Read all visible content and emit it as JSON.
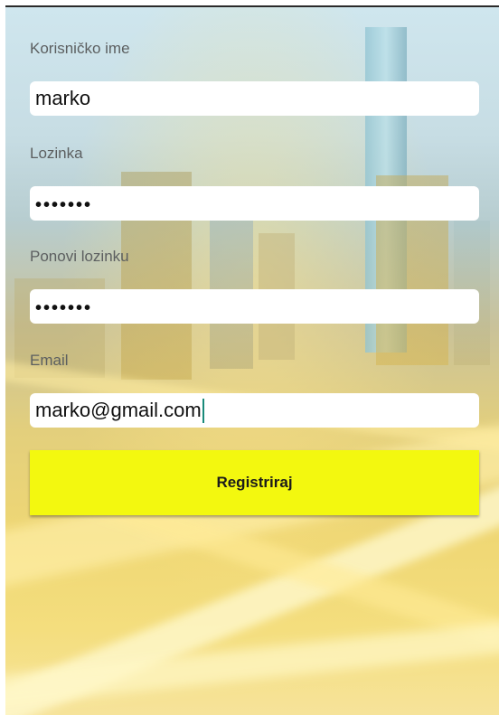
{
  "form": {
    "username_label": "Korisničko ime",
    "username_value": "marko",
    "password_label": "Lozinka",
    "password_value": "•••••••",
    "repeat_label": "Ponovi lozinku",
    "repeat_value": "•••••••",
    "email_label": "Email",
    "email_value": "marko@gmail.com"
  },
  "actions": {
    "register_label": "Registriraj"
  },
  "colors": {
    "button": "#f3f80f",
    "caret": "#1a8a7a",
    "label": "#5c5f60"
  }
}
